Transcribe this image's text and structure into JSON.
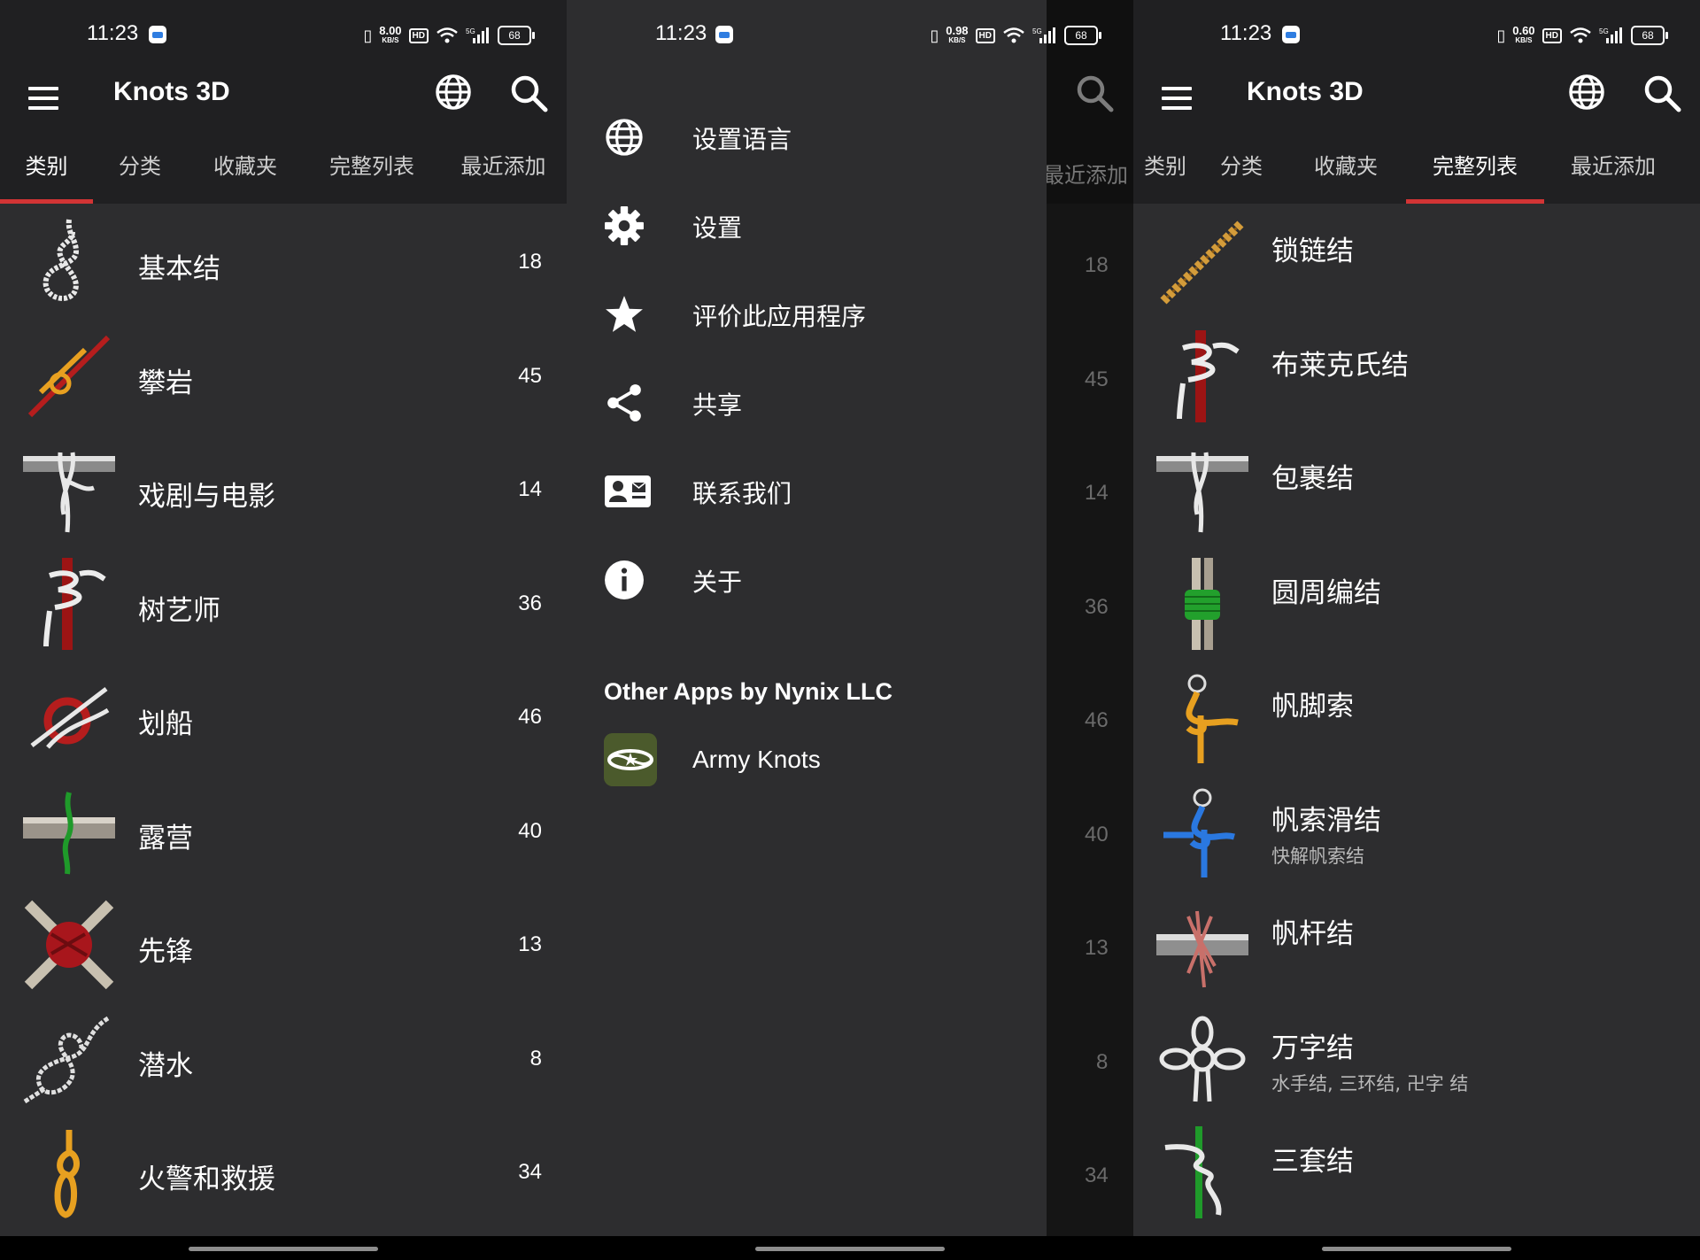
{
  "status": {
    "time": "11:23",
    "battery": "68",
    "speed_unit": "KB/S",
    "hd": "HD",
    "network": "5G",
    "speeds": [
      "8.00",
      "0.98",
      "0.60"
    ]
  },
  "app": {
    "title": "Knots 3D"
  },
  "tabs": [
    "类别",
    "分类",
    "收藏夹",
    "完整列表",
    "最近添加"
  ],
  "categories": [
    {
      "label": "基本结",
      "count": "18",
      "icon": "overhand-loop-knot-icon"
    },
    {
      "label": "攀岩",
      "count": "45",
      "icon": "climbing-knot-icon"
    },
    {
      "label": "戏剧与电影",
      "count": "14",
      "icon": "pipe-hitch-icon"
    },
    {
      "label": "树艺师",
      "count": "36",
      "icon": "arborist-hitch-icon"
    },
    {
      "label": "划船",
      "count": "46",
      "icon": "boating-knot-icon"
    },
    {
      "label": "露营",
      "count": "40",
      "icon": "camping-hitch-icon"
    },
    {
      "label": "先锋",
      "count": "13",
      "icon": "lashing-knot-icon"
    },
    {
      "label": "潜水",
      "count": "8",
      "icon": "diving-knot-icon"
    },
    {
      "label": "火警和救援",
      "count": "34",
      "icon": "rescue-loop-icon"
    }
  ],
  "drawer": {
    "items": [
      {
        "label": "设置语言",
        "icon": "globe-icon"
      },
      {
        "label": "设置",
        "icon": "gear-icon"
      },
      {
        "label": "评价此应用程序",
        "icon": "star-icon"
      },
      {
        "label": "共享",
        "icon": "share-icon"
      },
      {
        "label": "联系我们",
        "icon": "contact-card-icon"
      },
      {
        "label": "关于",
        "icon": "info-icon"
      }
    ],
    "other_apps_title": "Other Apps by Nynix LLC",
    "other_apps": [
      {
        "label": "Army Knots",
        "icon": "army-knots-logo"
      }
    ]
  },
  "full_list": [
    {
      "label": "锁链结",
      "sub": "",
      "icon": "chain-sinnet-icon"
    },
    {
      "label": "布莱克氏结",
      "sub": "",
      "icon": "blakes-hitch-icon"
    },
    {
      "label": "包裹结",
      "sub": "",
      "icon": "parcel-knot-icon"
    },
    {
      "label": "圆周编结",
      "sub": "",
      "icon": "round-lashing-icon"
    },
    {
      "label": "帆脚索",
      "sub": "",
      "icon": "bowline-icon"
    },
    {
      "label": "帆索滑结",
      "sub": "快解帆索结",
      "icon": "slipped-bowline-icon"
    },
    {
      "label": "帆杆结",
      "sub": "",
      "icon": "boom-hitch-icon"
    },
    {
      "label": "万字结",
      "sub": "水手结, 三环结, 卍字 结",
      "icon": "manrope-knot-icon"
    },
    {
      "label": "三套结",
      "sub": "",
      "icon": "triple-hitch-icon"
    }
  ],
  "colors": {
    "background": "#2d2d2f",
    "appbar": "#202022",
    "accent": "#d23435",
    "text": "#ffffff",
    "muted": "#b9b9b9"
  }
}
